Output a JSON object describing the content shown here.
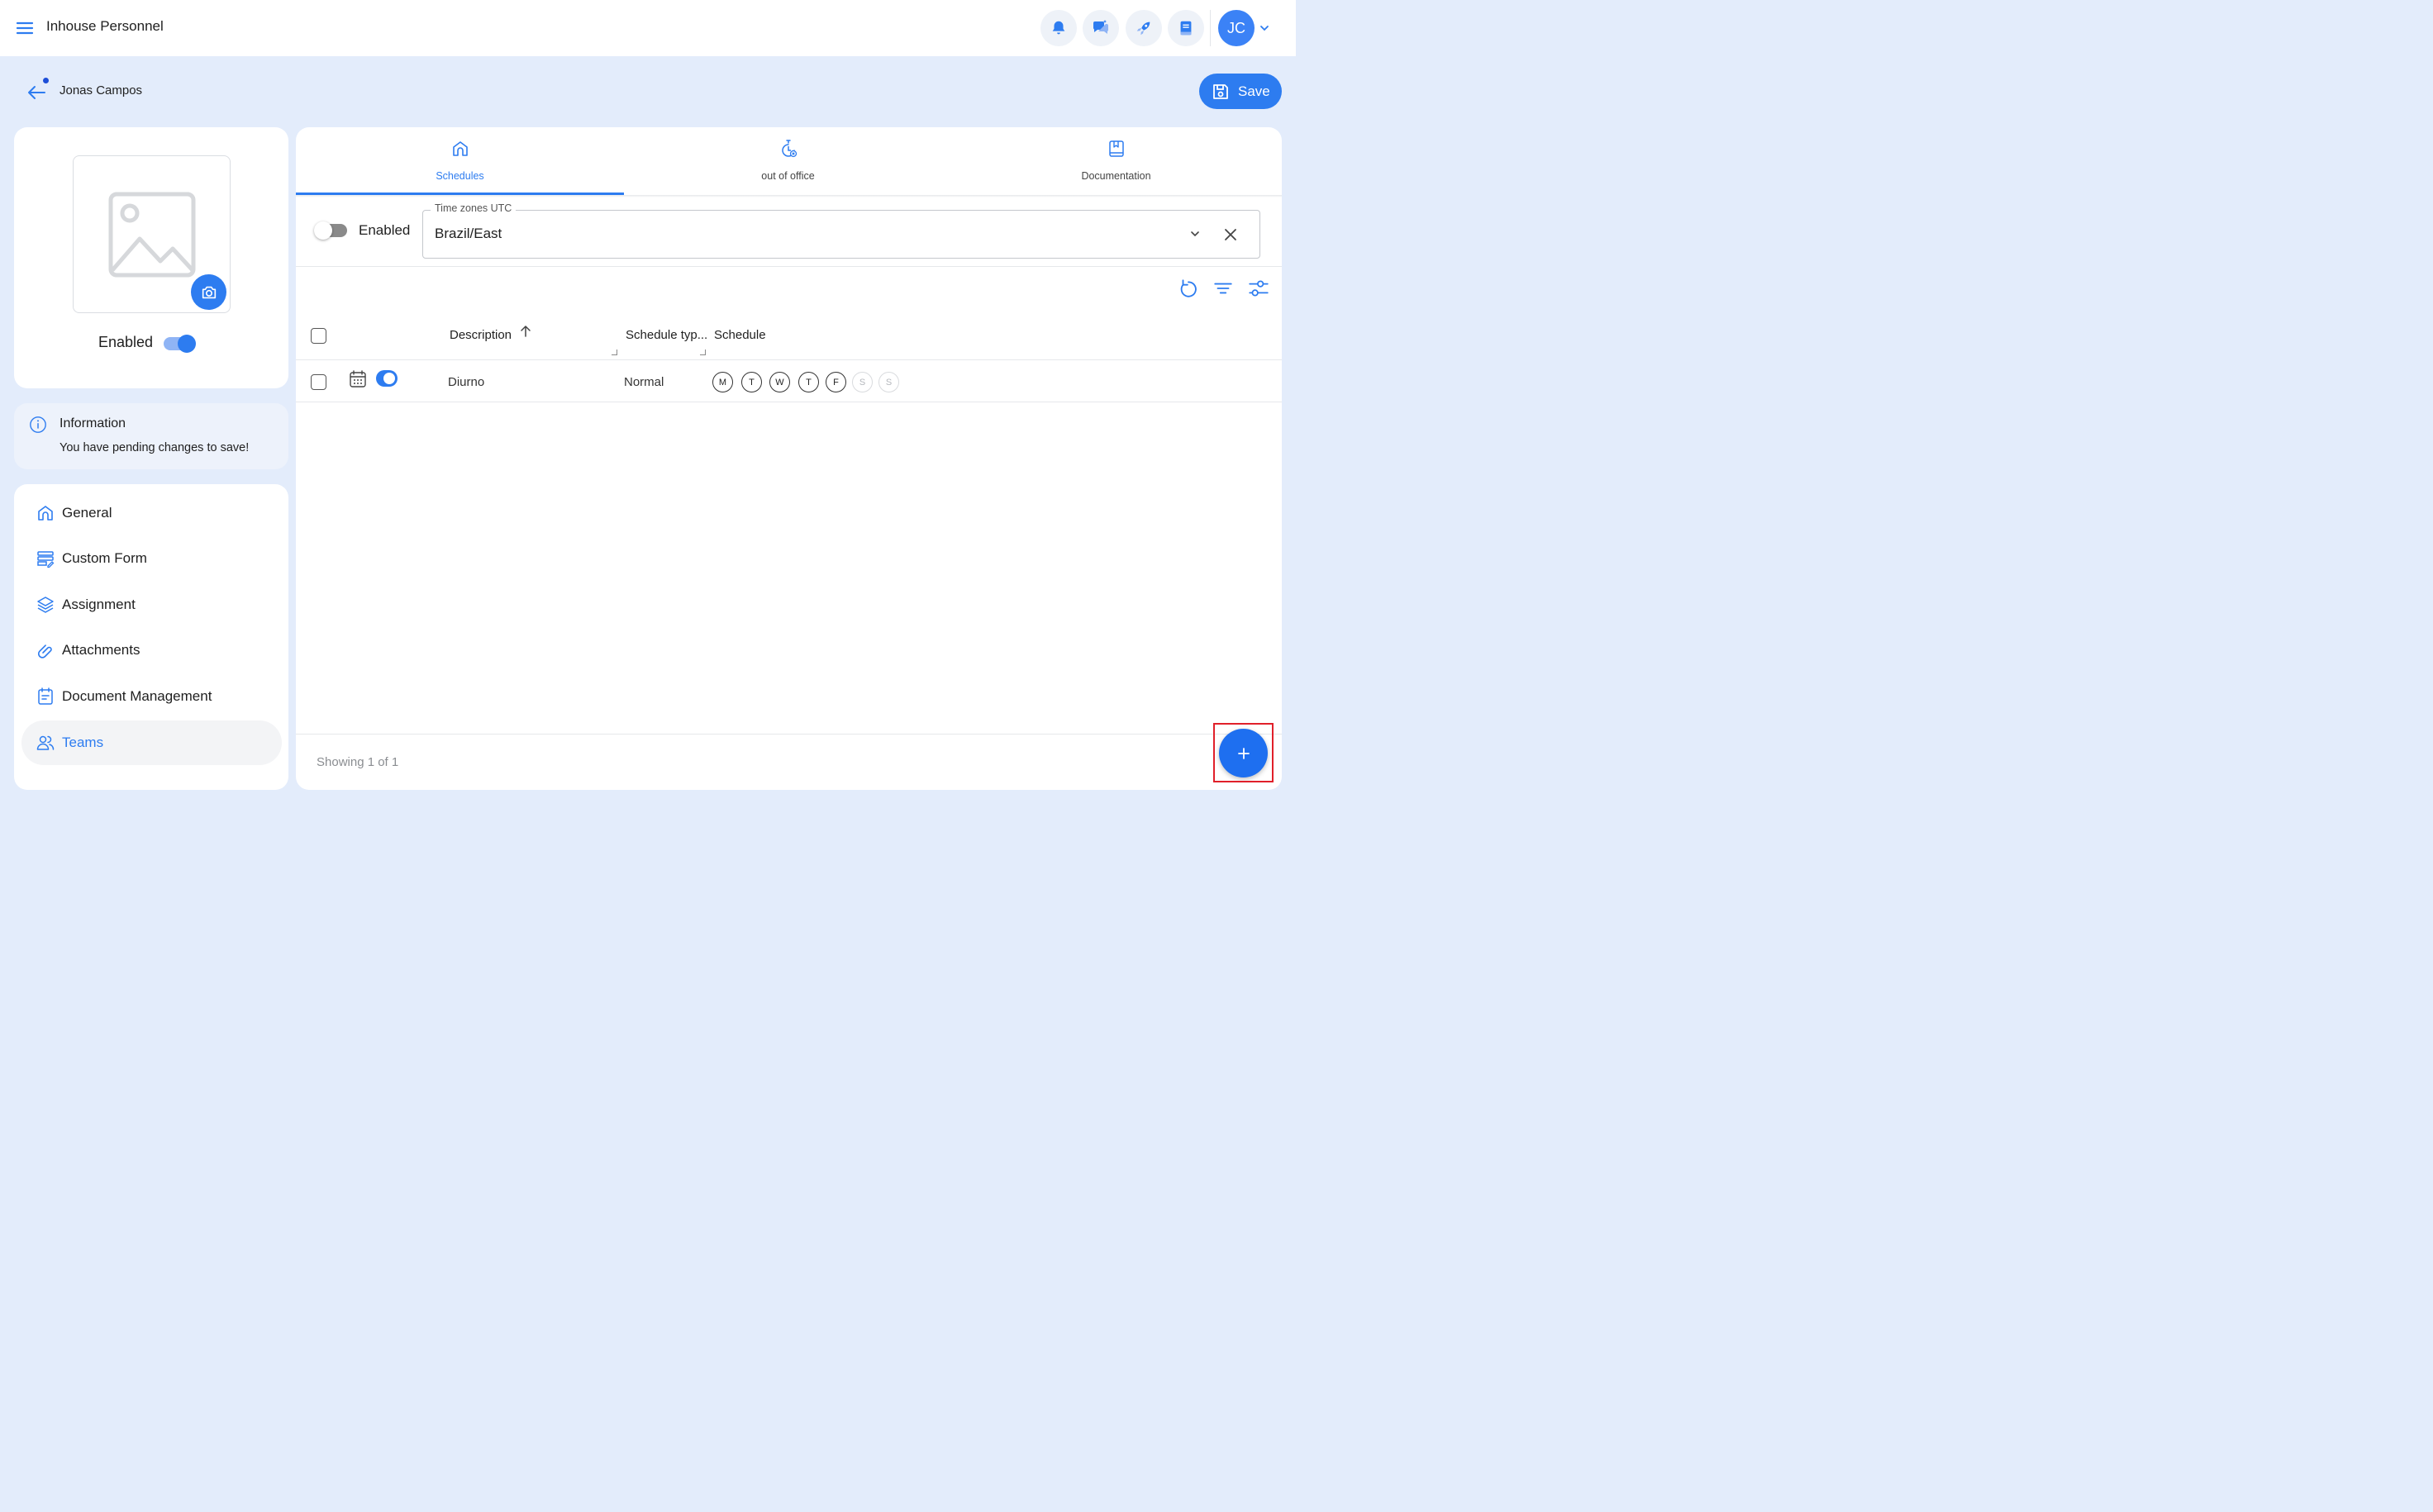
{
  "app": {
    "title": "Inhouse Personnel"
  },
  "topbar": {
    "icons": [
      "bell-icon",
      "chat-sparkle-icon",
      "rocket-icon",
      "book-icon"
    ],
    "avatar_initials": "JC"
  },
  "header": {
    "person_name": "Jonas Campos",
    "save_label": "Save"
  },
  "profile": {
    "enabled_label": "Enabled",
    "enabled": true
  },
  "info": {
    "title": "Information",
    "message": "You have pending changes to save!"
  },
  "sidebar": {
    "items": [
      {
        "label": "General",
        "icon": "home-icon",
        "active": false
      },
      {
        "label": "Custom Form",
        "icon": "form-icon",
        "active": false
      },
      {
        "label": "Assignment",
        "icon": "layers-icon",
        "active": false
      },
      {
        "label": "Attachments",
        "icon": "paperclip-icon",
        "active": false
      },
      {
        "label": "Document Management",
        "icon": "document-icon",
        "active": false
      },
      {
        "label": "Teams",
        "icon": "users-icon",
        "active": true
      }
    ]
  },
  "tabs": [
    {
      "label": "Schedules",
      "icon": "home-icon",
      "active": true
    },
    {
      "label": "out of office",
      "icon": "timer-icon",
      "active": false
    },
    {
      "label": "Documentation",
      "icon": "bookmark-book-icon",
      "active": false
    }
  ],
  "timezone": {
    "enabled_label": "Enabled",
    "enabled": false,
    "field_label": "Time zones UTC",
    "value": "Brazil/East"
  },
  "toolbar": {
    "icons": [
      "refresh-icon",
      "filter-icon",
      "settings-sliders-icon"
    ]
  },
  "table": {
    "columns": {
      "description": "Description",
      "schedule_type": "Schedule typ...",
      "schedule": "Schedule"
    },
    "rows": [
      {
        "description": "Diurno",
        "schedule_type": "Normal",
        "enabled": true,
        "days": [
          {
            "label": "M",
            "active": true
          },
          {
            "label": "T",
            "active": true
          },
          {
            "label": "W",
            "active": true
          },
          {
            "label": "T",
            "active": true
          },
          {
            "label": "F",
            "active": true
          },
          {
            "label": "S",
            "active": false
          },
          {
            "label": "S",
            "active": false
          }
        ]
      }
    ]
  },
  "footer": {
    "showing": "Showing 1 of 1",
    "add_label": "+"
  },
  "colors": {
    "accent": "#2d7cf0",
    "background": "#e3ecfb",
    "highlight": "#e0202a"
  }
}
